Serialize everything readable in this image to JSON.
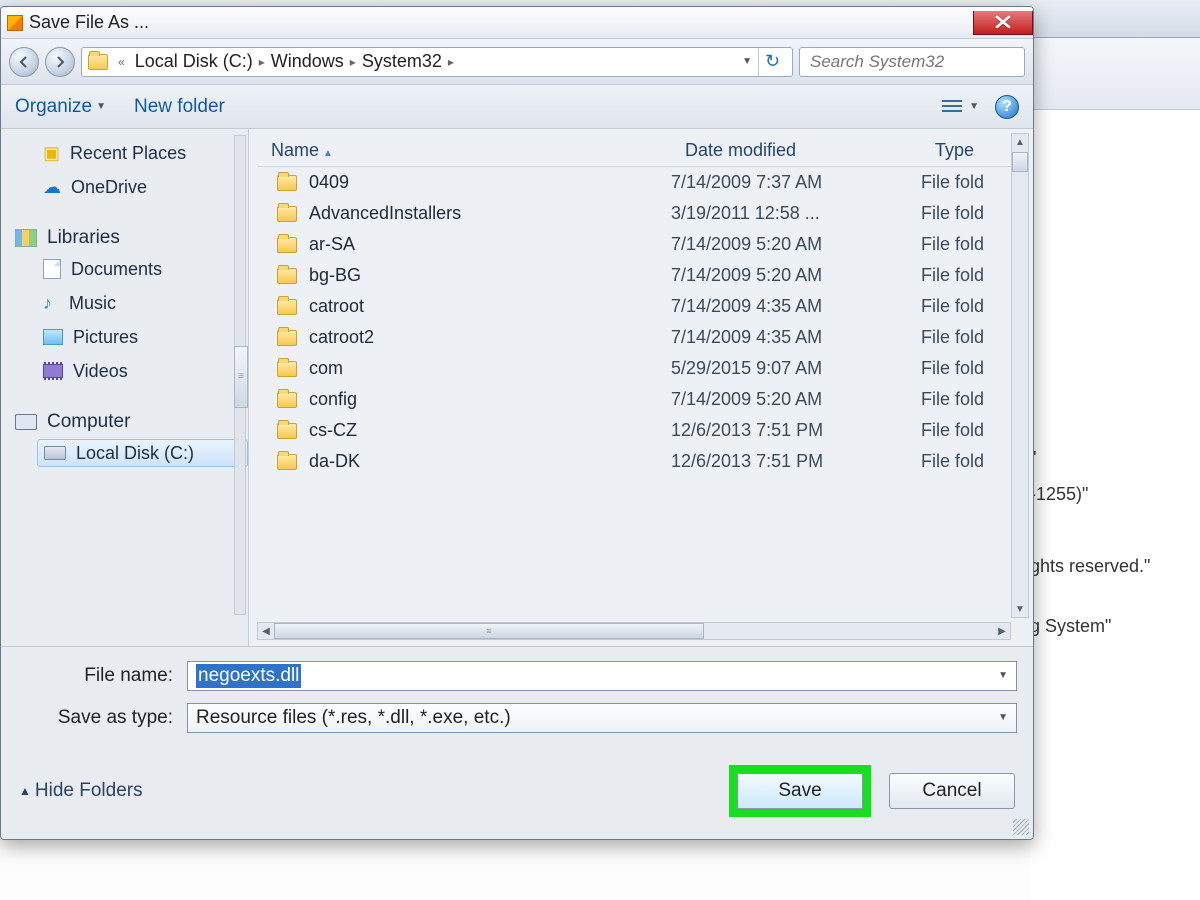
{
  "bg": {
    "frag1": "\"",
    "frag2": "-1255)\"",
    "frag3": "ghts reserved.\"",
    "frag4": "g System\""
  },
  "title": "Save File As ...",
  "breadcrumbs": [
    "Local Disk (C:)",
    "Windows",
    "System32"
  ],
  "search_placeholder": "Search System32",
  "toolbar": {
    "organize": "Organize",
    "new_folder": "New folder"
  },
  "sidebar": {
    "recent": "Recent Places",
    "onedrive": "OneDrive",
    "libraries": "Libraries",
    "documents": "Documents",
    "music": "Music",
    "pictures": "Pictures",
    "videos": "Videos",
    "computer": "Computer",
    "local_disk": "Local Disk (C:)"
  },
  "columns": {
    "name": "Name",
    "date": "Date modified",
    "type": "Type"
  },
  "files": [
    {
      "name": "0409",
      "date": "7/14/2009 7:37 AM",
      "type": "File fold"
    },
    {
      "name": "AdvancedInstallers",
      "date": "3/19/2011 12:58 ...",
      "type": "File fold"
    },
    {
      "name": "ar-SA",
      "date": "7/14/2009 5:20 AM",
      "type": "File fold"
    },
    {
      "name": "bg-BG",
      "date": "7/14/2009 5:20 AM",
      "type": "File fold"
    },
    {
      "name": "catroot",
      "date": "7/14/2009 4:35 AM",
      "type": "File fold"
    },
    {
      "name": "catroot2",
      "date": "7/14/2009 4:35 AM",
      "type": "File fold"
    },
    {
      "name": "com",
      "date": "5/29/2015 9:07 AM",
      "type": "File fold"
    },
    {
      "name": "config",
      "date": "7/14/2009 5:20 AM",
      "type": "File fold"
    },
    {
      "name": "cs-CZ",
      "date": "12/6/2013 7:51 PM",
      "type": "File fold"
    },
    {
      "name": "da-DK",
      "date": "12/6/2013 7:51 PM",
      "type": "File fold"
    }
  ],
  "form": {
    "file_name_label": "File name:",
    "file_name_value": "negoexts.dll",
    "save_type_label": "Save as type:",
    "save_type_value": "Resource files (*.res, *.dll, *.exe, etc.)"
  },
  "buttons": {
    "hide_folders": "Hide Folders",
    "save": "Save",
    "cancel": "Cancel"
  }
}
